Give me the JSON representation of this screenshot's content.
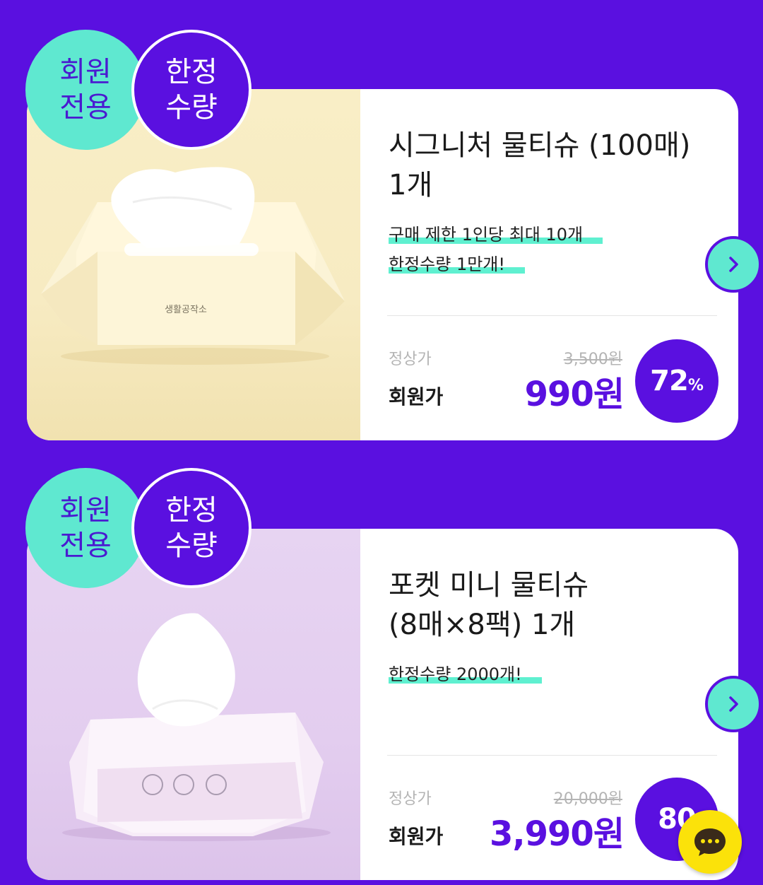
{
  "badges": {
    "member": [
      "회원",
      "전용"
    ],
    "limited": [
      "한정",
      "수량"
    ]
  },
  "products": [
    {
      "brand_text": "생활공작소",
      "title_lines": [
        "시그니처 물티슈 (100매)",
        "1개"
      ],
      "notes": [
        "구매 제한 1인당 최대 10개",
        "한정수량 1만개!"
      ],
      "regular_label": "정상가",
      "regular_price": "3,500원",
      "member_label": "회원가",
      "member_price": "990원",
      "discount_number": "72",
      "discount_unit": "%"
    },
    {
      "title_lines": [
        "포켓 미니 물티슈",
        "(8매×8팩) 1개"
      ],
      "notes": [
        "한정수량 2000개!"
      ],
      "regular_label": "정상가",
      "regular_price": "20,000원",
      "member_label": "회원가",
      "member_price": "3,990원",
      "discount_number": "80"
    }
  ],
  "icons": {
    "arrow": "chevron-right-icon",
    "chat": "chat-bubble-icon"
  },
  "colors": {
    "background": "#5a10e0",
    "mint": "#5fe8d0",
    "price": "#5a10e0",
    "chat": "#fbe20a"
  }
}
